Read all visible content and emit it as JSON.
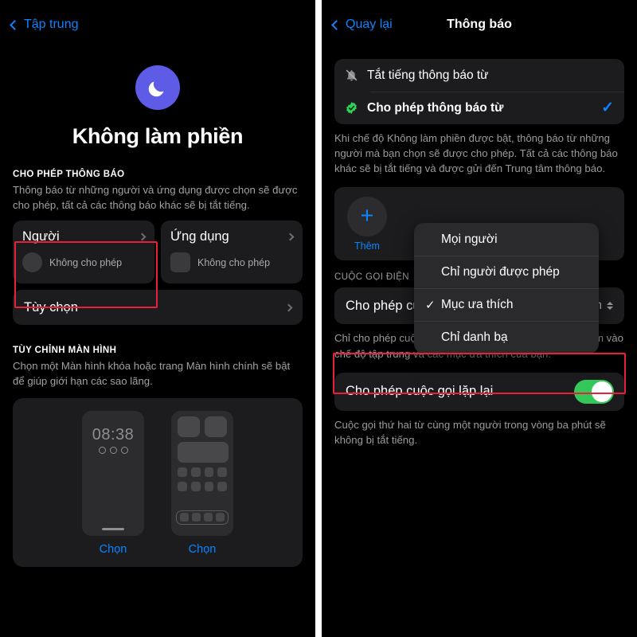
{
  "left": {
    "nav": {
      "back_label": "Tập trung",
      "back_icon": "chevron-left-icon"
    },
    "hero": {
      "icon": "moon-icon",
      "title": "Không làm phiền",
      "accent": "#5E5CE6"
    },
    "notifications_section": {
      "header": "CHO PHÉP THÔNG BÁO",
      "description": "Thông báo từ những người và ứng dụng được chọn sẽ được cho phép, tất cả các thông báo khác sẽ bị tắt tiếng.",
      "cards": [
        {
          "title": "Người",
          "subtitle": "Không cho phép",
          "avatar": "circle",
          "chevron": "chevron-right-icon"
        },
        {
          "title": "Ứng dụng",
          "subtitle": "Không cho phép",
          "avatar": "square",
          "chevron": "chevron-right-icon"
        }
      ]
    },
    "options_row": {
      "label": "Tùy chọn",
      "chevron": "chevron-right-icon"
    },
    "screen_section": {
      "header": "TÙY CHỈNH MÀN HÌNH",
      "description": "Chọn một Màn hình khóa hoặc trang Màn hình chính sẽ bật để giúp giới hạn các sao lãng.",
      "previews": [
        {
          "type": "lock-screen",
          "time": "08:38",
          "action": "Chọn"
        },
        {
          "type": "home-screen",
          "action": "Chọn"
        }
      ]
    },
    "highlight_color": "#E8203A"
  },
  "right": {
    "nav": {
      "back_label": "Quay lại",
      "title": "Thông báo",
      "back_icon": "chevron-left-icon"
    },
    "mode_options": [
      {
        "label": "Tắt tiếng thông báo từ",
        "icon": "bell-slash-icon",
        "selected": false,
        "check": ""
      },
      {
        "label": "Cho phép thông báo từ",
        "icon": "green-check-badge-icon",
        "selected": true,
        "check": "✓"
      }
    ],
    "mode_description": "Khi chế độ Không làm phiền được bật, thông báo từ những người mà bạn chọn sẽ được cho phép. Tất cả các thông báo khác sẽ bị tắt tiếng và được gửi đến Trung tâm thông báo.",
    "people_card": {
      "add_icon": "plus-icon",
      "add_label": "Thêm"
    },
    "calls_section_header": "CUỘC GỌI ĐIỆN",
    "calls_from_row": {
      "label": "Cho phép cuộc gọi từ",
      "value": "Mục ưa thích",
      "icon": "up-down-chevron-icon"
    },
    "calls_from_description": "Chỉ cho phép cuộc gọi đến từ các liên hệ mà bạn đã thêm vào chế độ tập trung và các mục ưa thích của bạn.",
    "repeat_calls_row": {
      "label": "Cho phép cuộc gọi lặp lại",
      "toggle_on": true,
      "toggle_color": "#34C759"
    },
    "repeat_calls_description": "Cuộc gọi thứ hai từ cùng một người trong vòng ba phút sẽ không bị tắt tiếng.",
    "popup_menu": {
      "items": [
        {
          "label": "Mọi người",
          "checked": false,
          "tick": ""
        },
        {
          "label": "Chỉ người được phép",
          "checked": false,
          "tick": ""
        },
        {
          "label": "Mục ưa thích",
          "checked": true,
          "tick": "✓"
        },
        {
          "label": "Chỉ danh bạ",
          "checked": false,
          "tick": ""
        }
      ]
    },
    "highlight_color": "#E8203A"
  }
}
